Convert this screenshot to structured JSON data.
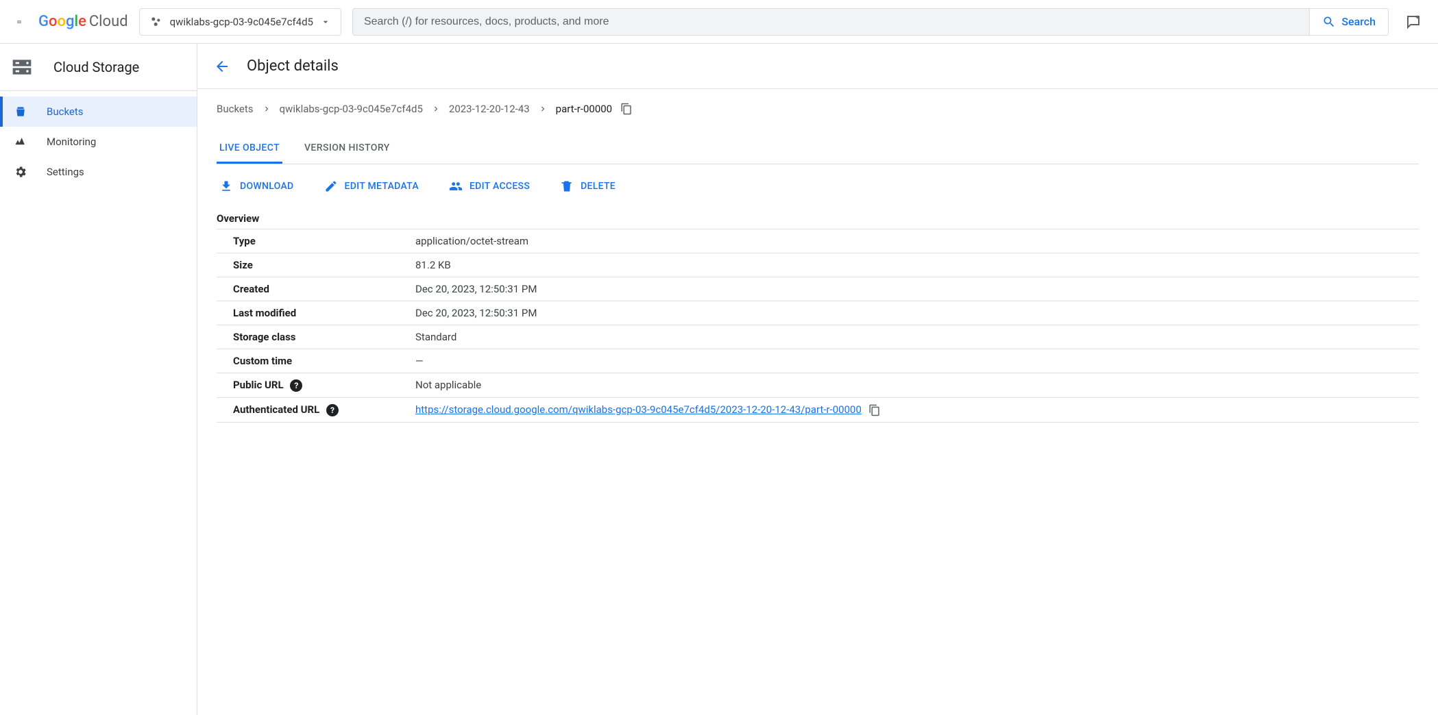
{
  "header": {
    "logo_text": "Cloud",
    "project_name": "qwiklabs-gcp-03-9c045e7cf4d5",
    "search_placeholder": "Search (/) for resources, docs, products, and more",
    "search_button": "Search"
  },
  "sidebar": {
    "product": "Cloud Storage",
    "items": [
      {
        "label": "Buckets"
      },
      {
        "label": "Monitoring"
      },
      {
        "label": "Settings"
      }
    ]
  },
  "page": {
    "title": "Object details",
    "breadcrumb": {
      "root": "Buckets",
      "bucket": "qwiklabs-gcp-03-9c045e7cf4d5",
      "folder": "2023-12-20-12-43",
      "object": "part-r-00000"
    },
    "tabs": {
      "live": "LIVE OBJECT",
      "history": "VERSION HISTORY"
    },
    "actions": {
      "download": "DOWNLOAD",
      "edit_metadata": "EDIT METADATA",
      "edit_access": "EDIT ACCESS",
      "delete": "DELETE"
    },
    "overview": {
      "heading": "Overview",
      "rows": {
        "type": {
          "k": "Type",
          "v": "application/octet-stream"
        },
        "size": {
          "k": "Size",
          "v": "81.2 KB"
        },
        "created": {
          "k": "Created",
          "v": "Dec 20, 2023, 12:50:31 PM"
        },
        "modified": {
          "k": "Last modified",
          "v": "Dec 20, 2023, 12:50:31 PM"
        },
        "storage_class": {
          "k": "Storage class",
          "v": "Standard"
        },
        "custom_time": {
          "k": "Custom time",
          "v": "—"
        },
        "public_url": {
          "k": "Public URL",
          "v": "Not applicable"
        },
        "auth_url": {
          "k": "Authenticated URL",
          "v": "https://storage.cloud.google.com/qwiklabs-gcp-03-9c045e7cf4d5/2023-12-20-12-43/part-r-00000"
        }
      }
    }
  }
}
